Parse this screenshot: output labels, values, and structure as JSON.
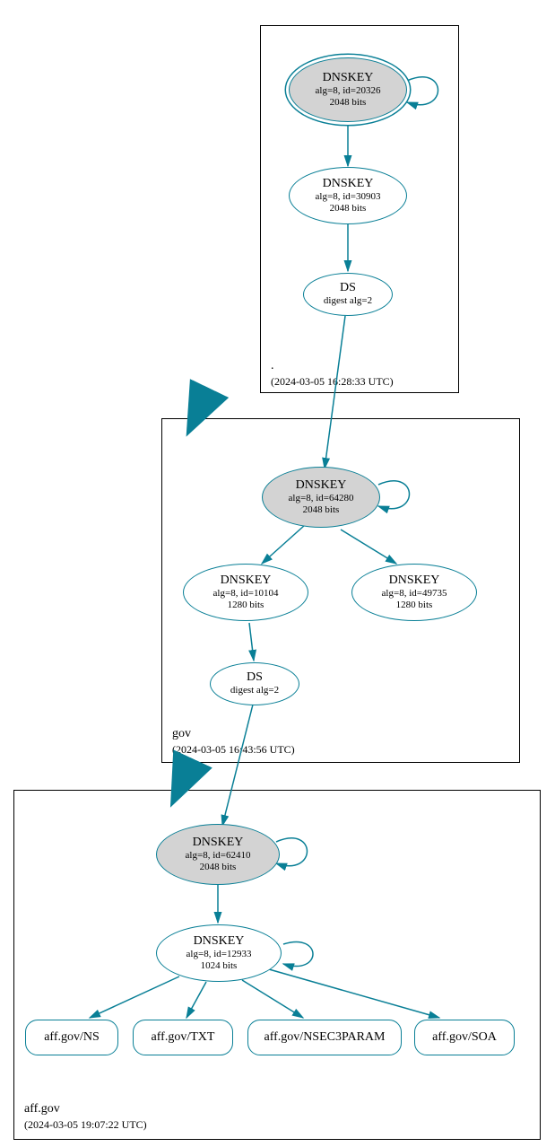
{
  "zones": {
    "root": {
      "label": ".",
      "timestamp": "(2024-03-05 16:28:33 UTC)"
    },
    "gov": {
      "label": "gov",
      "timestamp": "(2024-03-05 16:43:56 UTC)"
    },
    "affgov": {
      "label": "aff.gov",
      "timestamp": "(2024-03-05 19:07:22 UTC)"
    }
  },
  "nodes": {
    "root_ksk": {
      "title": "DNSKEY",
      "line1": "alg=8, id=20326",
      "line2": "2048 bits"
    },
    "root_zsk": {
      "title": "DNSKEY",
      "line1": "alg=8, id=30903",
      "line2": "2048 bits"
    },
    "root_ds": {
      "title": "DS",
      "line1": "digest alg=2"
    },
    "gov_ksk": {
      "title": "DNSKEY",
      "line1": "alg=8, id=64280",
      "line2": "2048 bits"
    },
    "gov_zsk1": {
      "title": "DNSKEY",
      "line1": "alg=8, id=10104",
      "line2": "1280 bits"
    },
    "gov_zsk2": {
      "title": "DNSKEY",
      "line1": "alg=8, id=49735",
      "line2": "1280 bits"
    },
    "gov_ds": {
      "title": "DS",
      "line1": "digest alg=2"
    },
    "aff_ksk": {
      "title": "DNSKEY",
      "line1": "alg=8, id=62410",
      "line2": "2048 bits"
    },
    "aff_zsk": {
      "title": "DNSKEY",
      "line1": "alg=8, id=12933",
      "line2": "1024 bits"
    },
    "rr_ns": {
      "title": "aff.gov/NS"
    },
    "rr_txt": {
      "title": "aff.gov/TXT"
    },
    "rr_nsec": {
      "title": "aff.gov/NSEC3PARAM"
    },
    "rr_soa": {
      "title": "aff.gov/SOA"
    }
  },
  "chart_data": {
    "type": "diagram",
    "description": "DNSSEC authentication chain graph",
    "zones": [
      {
        "name": ".",
        "timestamp": "2024-03-05 16:28:33 UTC",
        "keys": [
          {
            "type": "DNSKEY",
            "role": "KSK",
            "alg": 8,
            "id": 20326,
            "bits": 2048,
            "trust_anchor": true
          },
          {
            "type": "DNSKEY",
            "role": "ZSK",
            "alg": 8,
            "id": 30903,
            "bits": 2048
          }
        ],
        "ds": [
          {
            "digest_alg": 2,
            "target_zone": "gov"
          }
        ]
      },
      {
        "name": "gov",
        "timestamp": "2024-03-05 16:43:56 UTC",
        "keys": [
          {
            "type": "DNSKEY",
            "role": "KSK",
            "alg": 8,
            "id": 64280,
            "bits": 2048
          },
          {
            "type": "DNSKEY",
            "role": "ZSK",
            "alg": 8,
            "id": 10104,
            "bits": 1280
          },
          {
            "type": "DNSKEY",
            "alg": 8,
            "id": 49735,
            "bits": 1280
          }
        ],
        "ds": [
          {
            "digest_alg": 2,
            "target_zone": "aff.gov"
          }
        ]
      },
      {
        "name": "aff.gov",
        "timestamp": "2024-03-05 19:07:22 UTC",
        "keys": [
          {
            "type": "DNSKEY",
            "role": "KSK",
            "alg": 8,
            "id": 62410,
            "bits": 2048
          },
          {
            "type": "DNSKEY",
            "role": "ZSK",
            "alg": 8,
            "id": 12933,
            "bits": 1024
          }
        ],
        "rrsets": [
          "aff.gov/NS",
          "aff.gov/TXT",
          "aff.gov/NSEC3PARAM",
          "aff.gov/SOA"
        ]
      }
    ],
    "edges": [
      {
        "from": "root KSK 20326",
        "to": "root KSK 20326",
        "kind": "self-sign"
      },
      {
        "from": "root KSK 20326",
        "to": "root ZSK 30903",
        "kind": "signs"
      },
      {
        "from": "root ZSK 30903",
        "to": "DS gov",
        "kind": "signs"
      },
      {
        "from": "DS gov",
        "to": "gov KSK 64280",
        "kind": "delegation"
      },
      {
        "from": "gov KSK 64280",
        "to": "gov KSK 64280",
        "kind": "self-sign"
      },
      {
        "from": "gov KSK 64280",
        "to": "gov ZSK 10104",
        "kind": "signs"
      },
      {
        "from": "gov KSK 64280",
        "to": "gov DNSKEY 49735",
        "kind": "signs"
      },
      {
        "from": "gov ZSK 10104",
        "to": "DS aff.gov",
        "kind": "signs"
      },
      {
        "from": "DS aff.gov",
        "to": "aff.gov KSK 62410",
        "kind": "delegation"
      },
      {
        "from": "aff.gov KSK 62410",
        "to": "aff.gov KSK 62410",
        "kind": "self-sign"
      },
      {
        "from": "aff.gov KSK 62410",
        "to": "aff.gov ZSK 12933",
        "kind": "signs"
      },
      {
        "from": "aff.gov ZSK 12933",
        "to": "aff.gov ZSK 12933",
        "kind": "self-sign"
      },
      {
        "from": "aff.gov ZSK 12933",
        "to": "aff.gov/NS",
        "kind": "signs"
      },
      {
        "from": "aff.gov ZSK 12933",
        "to": "aff.gov/TXT",
        "kind": "signs"
      },
      {
        "from": "aff.gov ZSK 12933",
        "to": "aff.gov/NSEC3PARAM",
        "kind": "signs"
      },
      {
        "from": "aff.gov ZSK 12933",
        "to": "aff.gov/SOA",
        "kind": "signs"
      }
    ]
  }
}
